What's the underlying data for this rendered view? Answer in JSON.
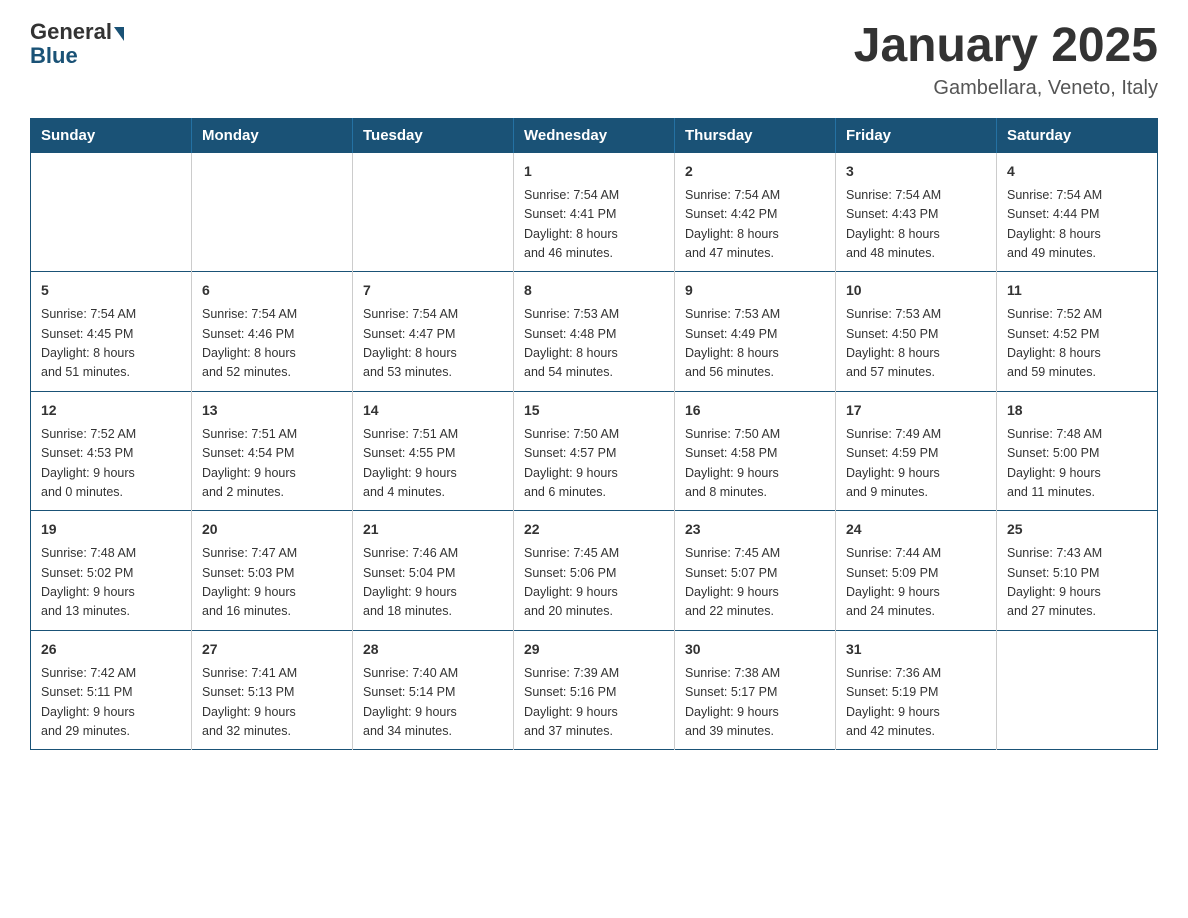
{
  "header": {
    "logo_general": "General",
    "logo_blue": "Blue",
    "title": "January 2025",
    "subtitle": "Gambellara, Veneto, Italy"
  },
  "days_of_week": [
    "Sunday",
    "Monday",
    "Tuesday",
    "Wednesday",
    "Thursday",
    "Friday",
    "Saturday"
  ],
  "weeks": [
    [
      {
        "day": "",
        "info": ""
      },
      {
        "day": "",
        "info": ""
      },
      {
        "day": "",
        "info": ""
      },
      {
        "day": "1",
        "info": "Sunrise: 7:54 AM\nSunset: 4:41 PM\nDaylight: 8 hours\nand 46 minutes."
      },
      {
        "day": "2",
        "info": "Sunrise: 7:54 AM\nSunset: 4:42 PM\nDaylight: 8 hours\nand 47 minutes."
      },
      {
        "day": "3",
        "info": "Sunrise: 7:54 AM\nSunset: 4:43 PM\nDaylight: 8 hours\nand 48 minutes."
      },
      {
        "day": "4",
        "info": "Sunrise: 7:54 AM\nSunset: 4:44 PM\nDaylight: 8 hours\nand 49 minutes."
      }
    ],
    [
      {
        "day": "5",
        "info": "Sunrise: 7:54 AM\nSunset: 4:45 PM\nDaylight: 8 hours\nand 51 minutes."
      },
      {
        "day": "6",
        "info": "Sunrise: 7:54 AM\nSunset: 4:46 PM\nDaylight: 8 hours\nand 52 minutes."
      },
      {
        "day": "7",
        "info": "Sunrise: 7:54 AM\nSunset: 4:47 PM\nDaylight: 8 hours\nand 53 minutes."
      },
      {
        "day": "8",
        "info": "Sunrise: 7:53 AM\nSunset: 4:48 PM\nDaylight: 8 hours\nand 54 minutes."
      },
      {
        "day": "9",
        "info": "Sunrise: 7:53 AM\nSunset: 4:49 PM\nDaylight: 8 hours\nand 56 minutes."
      },
      {
        "day": "10",
        "info": "Sunrise: 7:53 AM\nSunset: 4:50 PM\nDaylight: 8 hours\nand 57 minutes."
      },
      {
        "day": "11",
        "info": "Sunrise: 7:52 AM\nSunset: 4:52 PM\nDaylight: 8 hours\nand 59 minutes."
      }
    ],
    [
      {
        "day": "12",
        "info": "Sunrise: 7:52 AM\nSunset: 4:53 PM\nDaylight: 9 hours\nand 0 minutes."
      },
      {
        "day": "13",
        "info": "Sunrise: 7:51 AM\nSunset: 4:54 PM\nDaylight: 9 hours\nand 2 minutes."
      },
      {
        "day": "14",
        "info": "Sunrise: 7:51 AM\nSunset: 4:55 PM\nDaylight: 9 hours\nand 4 minutes."
      },
      {
        "day": "15",
        "info": "Sunrise: 7:50 AM\nSunset: 4:57 PM\nDaylight: 9 hours\nand 6 minutes."
      },
      {
        "day": "16",
        "info": "Sunrise: 7:50 AM\nSunset: 4:58 PM\nDaylight: 9 hours\nand 8 minutes."
      },
      {
        "day": "17",
        "info": "Sunrise: 7:49 AM\nSunset: 4:59 PM\nDaylight: 9 hours\nand 9 minutes."
      },
      {
        "day": "18",
        "info": "Sunrise: 7:48 AM\nSunset: 5:00 PM\nDaylight: 9 hours\nand 11 minutes."
      }
    ],
    [
      {
        "day": "19",
        "info": "Sunrise: 7:48 AM\nSunset: 5:02 PM\nDaylight: 9 hours\nand 13 minutes."
      },
      {
        "day": "20",
        "info": "Sunrise: 7:47 AM\nSunset: 5:03 PM\nDaylight: 9 hours\nand 16 minutes."
      },
      {
        "day": "21",
        "info": "Sunrise: 7:46 AM\nSunset: 5:04 PM\nDaylight: 9 hours\nand 18 minutes."
      },
      {
        "day": "22",
        "info": "Sunrise: 7:45 AM\nSunset: 5:06 PM\nDaylight: 9 hours\nand 20 minutes."
      },
      {
        "day": "23",
        "info": "Sunrise: 7:45 AM\nSunset: 5:07 PM\nDaylight: 9 hours\nand 22 minutes."
      },
      {
        "day": "24",
        "info": "Sunrise: 7:44 AM\nSunset: 5:09 PM\nDaylight: 9 hours\nand 24 minutes."
      },
      {
        "day": "25",
        "info": "Sunrise: 7:43 AM\nSunset: 5:10 PM\nDaylight: 9 hours\nand 27 minutes."
      }
    ],
    [
      {
        "day": "26",
        "info": "Sunrise: 7:42 AM\nSunset: 5:11 PM\nDaylight: 9 hours\nand 29 minutes."
      },
      {
        "day": "27",
        "info": "Sunrise: 7:41 AM\nSunset: 5:13 PM\nDaylight: 9 hours\nand 32 minutes."
      },
      {
        "day": "28",
        "info": "Sunrise: 7:40 AM\nSunset: 5:14 PM\nDaylight: 9 hours\nand 34 minutes."
      },
      {
        "day": "29",
        "info": "Sunrise: 7:39 AM\nSunset: 5:16 PM\nDaylight: 9 hours\nand 37 minutes."
      },
      {
        "day": "30",
        "info": "Sunrise: 7:38 AM\nSunset: 5:17 PM\nDaylight: 9 hours\nand 39 minutes."
      },
      {
        "day": "31",
        "info": "Sunrise: 7:36 AM\nSunset: 5:19 PM\nDaylight: 9 hours\nand 42 minutes."
      },
      {
        "day": "",
        "info": ""
      }
    ]
  ]
}
